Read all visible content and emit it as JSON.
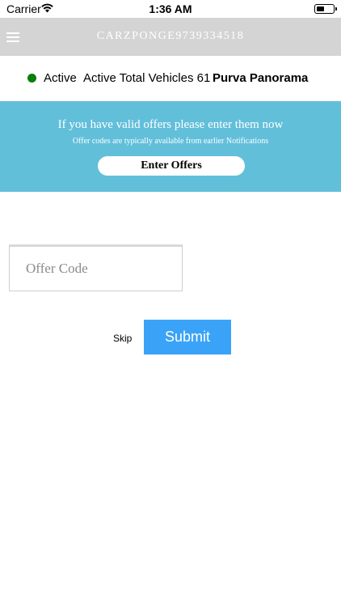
{
  "status_bar": {
    "carrier": "Carrier",
    "time": "1:36 AM"
  },
  "nav": {
    "title": "CARZPONGE9739334518",
    "menu_icon": "hamburger-menu-icon"
  },
  "status_row": {
    "status_label": "Active",
    "total_vehicles_text": "Active Total Vehicles 61",
    "location": "Purva Panorama",
    "status_color": "#0a7d0a"
  },
  "offer_banner": {
    "title": "If you have valid offers please enter them now",
    "subtitle": "Offer codes are typically available from earlier Notifications",
    "button_label": "Enter Offers",
    "background": "#62bfda"
  },
  "offer_form": {
    "placeholder": "Offer Code",
    "value": "",
    "skip_label": "Skip",
    "submit_label": "Submit",
    "submit_color": "#3ba3f7"
  }
}
